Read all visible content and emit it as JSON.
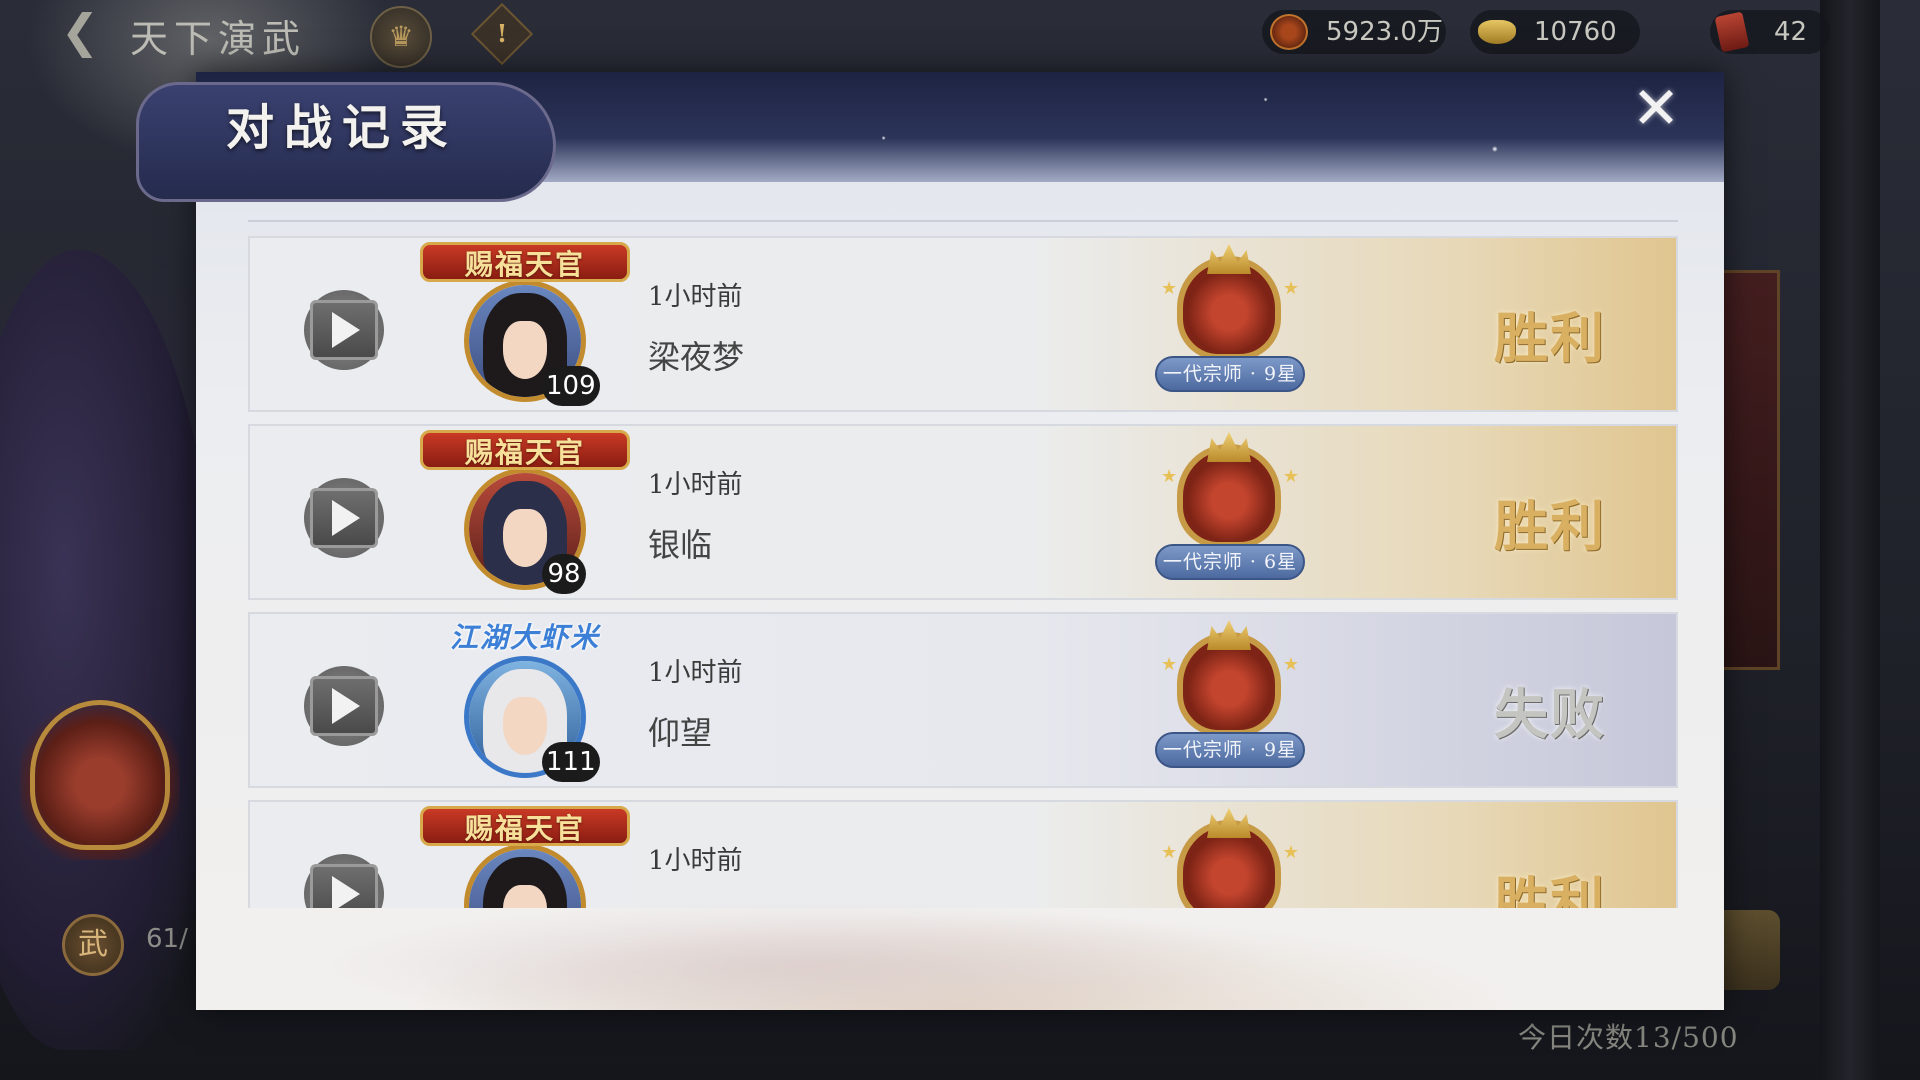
{
  "topbar": {
    "title": "天下演武",
    "currencies": [
      {
        "name": "coin",
        "value": "5923.0万"
      },
      {
        "name": "ingot",
        "value": "10760"
      },
      {
        "name": "token",
        "value": "42"
      }
    ]
  },
  "side": {
    "wu_label": "武",
    "count": "61/"
  },
  "daily": {
    "count_text": "今日次数13/500"
  },
  "modal": {
    "title": "对战记录",
    "close_label": "✕"
  },
  "records": [
    {
      "title": "赐福天官",
      "title_style": "gold",
      "level": "109",
      "time": "1小时前",
      "name": "梁夜梦",
      "rank": "一代宗师 · 9星",
      "result": "胜利",
      "outcome": "win"
    },
    {
      "title": "赐福天官",
      "title_style": "gold",
      "level": "98",
      "time": "1小时前",
      "name": "银临",
      "rank": "一代宗师 · 6星",
      "result": "胜利",
      "outcome": "win"
    },
    {
      "title": "江湖大虾米",
      "title_style": "blue",
      "level": "111",
      "time": "1小时前",
      "name": "仰望",
      "rank": "一代宗师 · 9星",
      "result": "失败",
      "outcome": "lose"
    },
    {
      "title": "赐福天官",
      "title_style": "gold",
      "level": "",
      "time": "1小时前",
      "name": "",
      "rank": "",
      "result": "胜利",
      "outcome": "win"
    }
  ],
  "colors": {
    "win": "#d9b062",
    "lose": "#c4c4c0",
    "header_bg": "#1d2342",
    "rank_badge": "#4d6aa0"
  }
}
